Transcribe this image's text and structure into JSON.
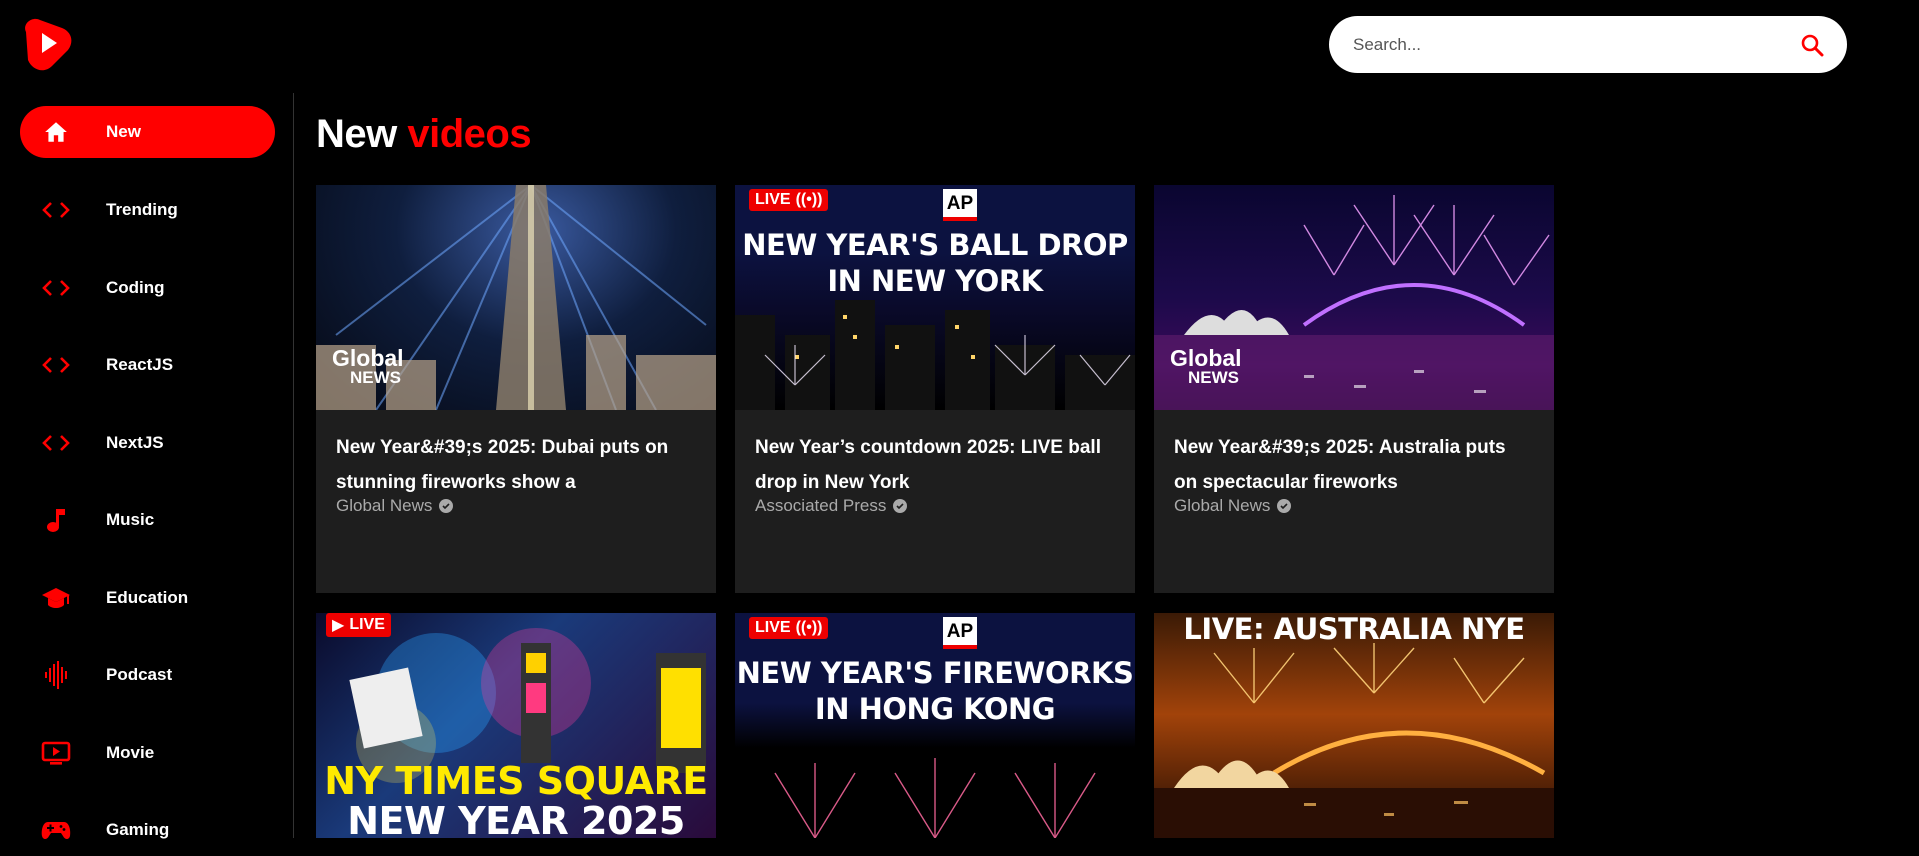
{
  "app": {
    "logo_icon": "play-logo-icon",
    "accent_color": "#ff0000"
  },
  "search": {
    "placeholder": "Search...",
    "icon": "search-icon"
  },
  "sidebar": {
    "items": [
      {
        "label": "New",
        "icon": "home-icon",
        "active": true
      },
      {
        "label": "Trending",
        "icon": "code-icon",
        "active": false
      },
      {
        "label": "Coding",
        "icon": "code-icon",
        "active": false
      },
      {
        "label": "ReactJS",
        "icon": "code-icon",
        "active": false
      },
      {
        "label": "NextJS",
        "icon": "code-icon",
        "active": false
      },
      {
        "label": "Music",
        "icon": "music-note-icon",
        "active": false
      },
      {
        "label": "Education",
        "icon": "graduation-cap-icon",
        "active": false
      },
      {
        "label": "Podcast",
        "icon": "waveform-icon",
        "active": false
      },
      {
        "label": "Movie",
        "icon": "tv-icon",
        "active": false
      },
      {
        "label": "Gaming",
        "icon": "gamepad-icon",
        "active": false
      }
    ]
  },
  "main": {
    "heading_word1": "New",
    "heading_word2": "videos",
    "videos": [
      {
        "title": "New Year&#39;s 2025: Dubai puts on stunning fireworks show a",
        "channel": "Global News",
        "thumb": {
          "logo_line1": "Global",
          "logo_line2": "NEWS"
        }
      },
      {
        "title": "New Year’s countdown 2025: LIVE ball drop in New York",
        "channel": "Associated Press",
        "thumb": {
          "live": "LIVE",
          "agency": "AP",
          "line1": "NEW YEAR'S BALL DROP",
          "line2": "IN NEW YORK"
        }
      },
      {
        "title": "New Year&#39;s 2025: Australia puts on spectacular fireworks",
        "channel": "Global News",
        "thumb": {
          "logo_line1": "Global",
          "logo_line2": "NEWS"
        }
      },
      {
        "title": "",
        "channel": "",
        "thumb": {
          "live": "LIVE",
          "line1": "NY TIMES SQUARE",
          "line2": "NEW YEAR 2025"
        }
      },
      {
        "title": "",
        "channel": "",
        "thumb": {
          "live": "LIVE",
          "agency": "AP",
          "line1": "NEW YEAR'S FIREWORKS",
          "line2": "IN HONG KONG"
        }
      },
      {
        "title": "",
        "channel": "",
        "thumb": {
          "line1": "LIVE: AUSTRALIA NYE"
        }
      }
    ]
  }
}
